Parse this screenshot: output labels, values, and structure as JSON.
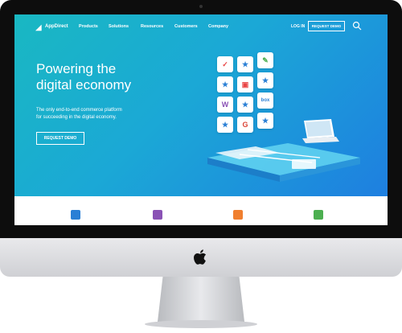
{
  "nav": {
    "logo": "AppDirect",
    "items": [
      "Products",
      "Solutions",
      "Resources",
      "Customers",
      "Company"
    ],
    "login": "LOG IN",
    "request_demo": "REQUEST DEMO"
  },
  "hero": {
    "headline_line1": "Powering the",
    "headline_line2": "digital economy",
    "subtitle_line1": "The only end-to-end commerce platform",
    "subtitle_line2": "for succeeding in the digital economy.",
    "cta": "REQUEST DEMO"
  },
  "tiles": {
    "box_label": "box",
    "google_label": "G",
    "wrike_label": "W"
  },
  "colors": {
    "gradient_start": "#19b8c2",
    "gradient_end": "#1e7fe0",
    "feature_blue": "#2a7fd5",
    "feature_purple": "#8a52b5",
    "feature_orange": "#f07f2f",
    "feature_green": "#4caf50"
  },
  "features": [
    {
      "icon": "shopping-bag-star-icon"
    },
    {
      "icon": "grid-pattern-icon"
    },
    {
      "icon": "storefront-icon"
    },
    {
      "icon": "receipt-dollar-icon"
    }
  ]
}
